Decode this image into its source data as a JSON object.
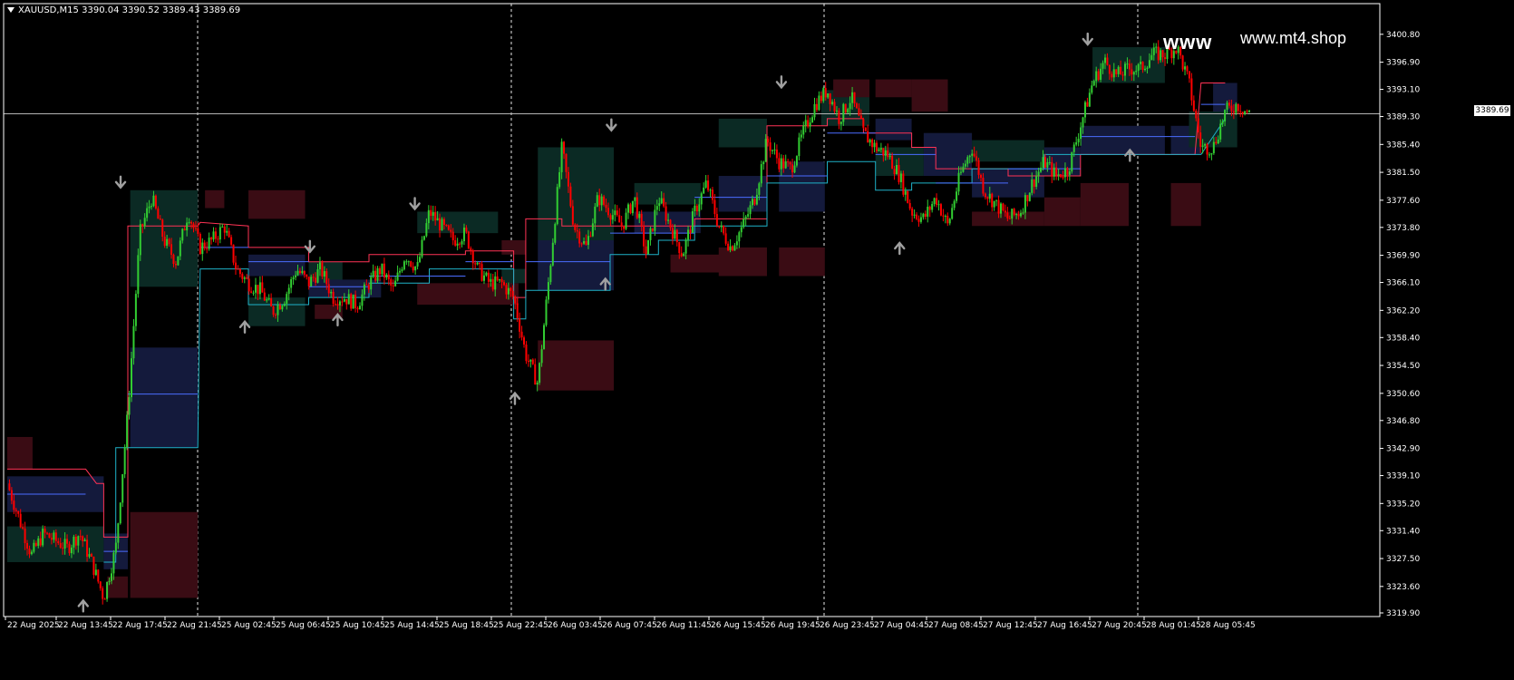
{
  "header": {
    "symbol": "XAUUSD,M15",
    "ohlc": "3390.04 3390.52 3389.43 3389.69"
  },
  "watermark": {
    "large": "www",
    "small": "www.mt4.shop"
  },
  "colors": {
    "background": "#000000",
    "grid": "#ffffff",
    "axis_text": "#ffffff",
    "bull": "#32cd32",
    "bear": "#ff0000",
    "arrow": "#a0a0a0",
    "zone_green": "#0b2a24",
    "zone_blue": "#141a3c",
    "zone_red": "#3a0c14",
    "resistance_line": "#ff3355",
    "support_line": "#1fb2c8",
    "mid_line": "#4a6cff",
    "bid_line": "#b4b4b4"
  },
  "chart_data": {
    "type": "candlestick",
    "symbol": "XAUUSD",
    "timeframe": "M15",
    "current_price": "3389.69",
    "ylim": [
      3319.9,
      3402.3
    ],
    "y_ticks": [
      "3400.80",
      "3396.90",
      "3393.10",
      "3389.30",
      "3385.40",
      "3381.50",
      "3377.60",
      "3373.80",
      "3369.90",
      "3366.10",
      "3362.20",
      "3358.40",
      "3354.50",
      "3350.60",
      "3346.80",
      "3342.90",
      "3339.10",
      "3335.20",
      "3331.40",
      "3327.50",
      "3323.60",
      "3319.90"
    ],
    "x_ticks": [
      "22 Aug 2025",
      "22 Aug 13:45",
      "22 Aug 17:45",
      "22 Aug 21:45",
      "25 Aug 02:45",
      "25 Aug 06:45",
      "25 Aug 10:45",
      "25 Aug 14:45",
      "25 Aug 18:45",
      "25 Aug 22:45",
      "26 Aug 03:45",
      "26 Aug 07:45",
      "26 Aug 11:45",
      "26 Aug 15:45",
      "26 Aug 19:45",
      "26 Aug 23:45",
      "27 Aug 04:45",
      "27 Aug 08:45",
      "27 Aug 12:45",
      "27 Aug 16:45",
      "27 Aug 20:45",
      "28 Aug 01:45",
      "28 Aug 05:45"
    ],
    "day_separators_after_tick": [
      2,
      8,
      14,
      19
    ],
    "price_path_anchors": [
      [
        0,
        3338
      ],
      [
        1,
        3333
      ],
      [
        2,
        3328
      ],
      [
        3,
        3331
      ],
      [
        4,
        3330
      ],
      [
        5,
        3329
      ],
      [
        6,
        3331
      ],
      [
        7,
        3327
      ],
      [
        8,
        3322
      ],
      [
        9,
        3329
      ],
      [
        10,
        3348
      ],
      [
        11,
        3373
      ],
      [
        12,
        3378
      ],
      [
        13,
        3372
      ],
      [
        14,
        3369
      ],
      [
        15,
        3376
      ],
      [
        16,
        3371
      ],
      [
        17,
        3372
      ],
      [
        18,
        3374
      ],
      [
        19,
        3368
      ],
      [
        20,
        3366
      ],
      [
        21,
        3365
      ],
      [
        22,
        3362
      ],
      [
        23,
        3364
      ],
      [
        24,
        3368
      ],
      [
        25,
        3366
      ],
      [
        26,
        3368
      ],
      [
        27,
        3364
      ],
      [
        28,
        3364
      ],
      [
        29,
        3363
      ],
      [
        30,
        3366
      ],
      [
        31,
        3368
      ],
      [
        32,
        3365
      ],
      [
        33,
        3370
      ],
      [
        34,
        3368
      ],
      [
        35,
        3376
      ],
      [
        36,
        3374
      ],
      [
        37,
        3372
      ],
      [
        38,
        3373
      ],
      [
        39,
        3368
      ],
      [
        40,
        3366
      ],
      [
        41,
        3366
      ],
      [
        42,
        3364
      ],
      [
        43,
        3356
      ],
      [
        44,
        3352
      ],
      [
        45,
        3368
      ],
      [
        46,
        3385
      ],
      [
        47,
        3374
      ],
      [
        48,
        3371
      ],
      [
        49,
        3378
      ],
      [
        50,
        3376
      ],
      [
        51,
        3374
      ],
      [
        52,
        3378
      ],
      [
        53,
        3370
      ],
      [
        54,
        3378
      ],
      [
        55,
        3374
      ],
      [
        56,
        3370
      ],
      [
        57,
        3376
      ],
      [
        58,
        3380
      ],
      [
        59,
        3374
      ],
      [
        60,
        3371
      ],
      [
        61,
        3374
      ],
      [
        62,
        3378
      ],
      [
        63,
        3386
      ],
      [
        64,
        3383
      ],
      [
        65,
        3382
      ],
      [
        66,
        3387
      ],
      [
        67,
        3391
      ],
      [
        68,
        3393
      ],
      [
        69,
        3389
      ],
      [
        70,
        3392
      ],
      [
        71,
        3387
      ],
      [
        72,
        3385
      ],
      [
        73,
        3384
      ],
      [
        74,
        3381
      ],
      [
        75,
        3376
      ],
      [
        76,
        3375
      ],
      [
        77,
        3378
      ],
      [
        78,
        3374
      ],
      [
        79,
        3381
      ],
      [
        80,
        3385
      ],
      [
        81,
        3379
      ],
      [
        82,
        3377
      ],
      [
        83,
        3375
      ],
      [
        84,
        3376
      ],
      [
        85,
        3380
      ],
      [
        86,
        3383
      ],
      [
        87,
        3381
      ],
      [
        88,
        3382
      ],
      [
        89,
        3388
      ],
      [
        90,
        3394
      ],
      [
        91,
        3397
      ],
      [
        92,
        3395
      ],
      [
        93,
        3396
      ],
      [
        94,
        3396
      ],
      [
        95,
        3398
      ],
      [
        96,
        3398
      ],
      [
        97,
        3399
      ],
      [
        98,
        3394
      ],
      [
        99,
        3385
      ],
      [
        100,
        3385
      ],
      [
        101,
        3390
      ],
      [
        102,
        3391
      ],
      [
        103,
        3389.7
      ]
    ],
    "zones": [
      {
        "x0": 0,
        "x1": 2.1,
        "y0": 3340,
        "y1": 3344.5,
        "kind": "red"
      },
      {
        "x0": 0,
        "x1": 8,
        "y0": 3332,
        "y1": 3327,
        "kind": "green"
      },
      {
        "x0": 0,
        "x1": 8,
        "y0": 3339,
        "y1": 3334,
        "kind": "blue"
      },
      {
        "x0": 8.3,
        "x1": 10,
        "y0": 3322,
        "y1": 3325,
        "kind": "red"
      },
      {
        "x0": 8,
        "x1": 10,
        "y0": 3331,
        "y1": 3326,
        "kind": "blue"
      },
      {
        "x0": 10.2,
        "x1": 15.8,
        "y0": 3322,
        "y1": 3334,
        "kind": "red"
      },
      {
        "x0": 10.2,
        "x1": 15.8,
        "y0": 3357,
        "y1": 3343,
        "kind": "blue"
      },
      {
        "x0": 10.2,
        "x1": 15.8,
        "y0": 3379,
        "y1": 3365.5,
        "kind": "green"
      },
      {
        "x0": 16.4,
        "x1": 18,
        "y0": 3376.5,
        "y1": 3379,
        "kind": "red"
      },
      {
        "x0": 20,
        "x1": 24.7,
        "y0": 3375,
        "y1": 3379,
        "kind": "red"
      },
      {
        "x0": 20,
        "x1": 24.7,
        "y0": 3367,
        "y1": 3370,
        "kind": "blue"
      },
      {
        "x0": 20,
        "x1": 24.7,
        "y0": 3364,
        "y1": 3360,
        "kind": "green"
      },
      {
        "x0": 25,
        "x1": 27.8,
        "y0": 3369,
        "y1": 3366,
        "kind": "green"
      },
      {
        "x0": 25.5,
        "x1": 27.8,
        "y0": 3361,
        "y1": 3363,
        "kind": "red"
      },
      {
        "x0": 25,
        "x1": 31,
        "y0": 3364,
        "y1": 3366.5,
        "kind": "blue"
      },
      {
        "x0": 34,
        "x1": 40.7,
        "y0": 3373,
        "y1": 3376,
        "kind": "green"
      },
      {
        "x0": 34,
        "x1": 42.4,
        "y0": 3363,
        "y1": 3366,
        "kind": "red"
      },
      {
        "x0": 41,
        "x1": 43,
        "y0": 3370,
        "y1": 3372,
        "kind": "red"
      },
      {
        "x0": 41,
        "x1": 43,
        "y0": 3366,
        "y1": 3368,
        "kind": "green"
      },
      {
        "x0": 44,
        "x1": 50.3,
        "y0": 3385,
        "y1": 3372,
        "kind": "green"
      },
      {
        "x0": 44,
        "x1": 50.3,
        "y0": 3372,
        "y1": 3365,
        "kind": "blue"
      },
      {
        "x0": 44,
        "x1": 50.3,
        "y0": 3358,
        "y1": 3351,
        "kind": "red"
      },
      {
        "x0": 52,
        "x1": 57.5,
        "y0": 3377,
        "y1": 3380,
        "kind": "green"
      },
      {
        "x0": 52,
        "x1": 57.5,
        "y0": 3373,
        "y1": 3376,
        "kind": "blue"
      },
      {
        "x0": 55,
        "x1": 61,
        "y0": 3370,
        "y1": 3367.5,
        "kind": "red"
      },
      {
        "x0": 59,
        "x1": 63,
        "y0": 3385,
        "y1": 3389,
        "kind": "green"
      },
      {
        "x0": 59,
        "x1": 63,
        "y0": 3376,
        "y1": 3381,
        "kind": "blue"
      },
      {
        "x0": 59,
        "x1": 63,
        "y0": 3371,
        "y1": 3367,
        "kind": "red"
      },
      {
        "x0": 64,
        "x1": 67.8,
        "y0": 3376,
        "y1": 3383,
        "kind": "blue"
      },
      {
        "x0": 64,
        "x1": 67.8,
        "y0": 3371,
        "y1": 3367,
        "kind": "red"
      },
      {
        "x0": 67.5,
        "x1": 71.5,
        "y0": 3388,
        "y1": 3393,
        "kind": "green"
      },
      {
        "x0": 68.5,
        "x1": 71.5,
        "y0": 3392,
        "y1": 3394.5,
        "kind": "red"
      },
      {
        "x0": 72,
        "x1": 75,
        "y0": 3392,
        "y1": 3394.5,
        "kind": "red"
      },
      {
        "x0": 72,
        "x1": 75,
        "y0": 3386,
        "y1": 3389,
        "kind": "blue"
      },
      {
        "x0": 75,
        "x1": 78,
        "y0": 3390,
        "y1": 3394.5,
        "kind": "red"
      },
      {
        "x0": 72,
        "x1": 76,
        "y0": 3381,
        "y1": 3385,
        "kind": "green"
      },
      {
        "x0": 76,
        "x1": 80,
        "y0": 3381,
        "y1": 3387,
        "kind": "blue"
      },
      {
        "x0": 80,
        "x1": 86,
        "y0": 3383,
        "y1": 3386,
        "kind": "green"
      },
      {
        "x0": 80,
        "x1": 86,
        "y0": 3374,
        "y1": 3376,
        "kind": "red"
      },
      {
        "x0": 80,
        "x1": 86,
        "y0": 3378,
        "y1": 3382,
        "kind": "blue"
      },
      {
        "x0": 86,
        "x1": 89,
        "y0": 3374,
        "y1": 3378,
        "kind": "red"
      },
      {
        "x0": 86,
        "x1": 89,
        "y0": 3381,
        "y1": 3385,
        "kind": "blue"
      },
      {
        "x0": 89,
        "x1": 93,
        "y0": 3374,
        "y1": 3380,
        "kind": "red"
      },
      {
        "x0": 89,
        "x1": 96,
        "y0": 3388,
        "y1": 3384,
        "kind": "blue"
      },
      {
        "x0": 90,
        "x1": 96,
        "y0": 3394,
        "y1": 3399,
        "kind": "green"
      },
      {
        "x0": 96.5,
        "x1": 99,
        "y0": 3374,
        "y1": 3380,
        "kind": "red"
      },
      {
        "x0": 96.5,
        "x1": 99,
        "y0": 3384,
        "y1": 3388,
        "kind": "blue"
      },
      {
        "x0": 98,
        "x1": 102,
        "y0": 3385,
        "y1": 3390,
        "kind": "green"
      },
      {
        "x0": 100,
        "x1": 102,
        "y0": 3390,
        "y1": 3394,
        "kind": "blue"
      }
    ],
    "resistance_line": [
      [
        0,
        3340
      ],
      [
        6.5,
        3340
      ],
      [
        7.4,
        3338
      ],
      [
        8,
        3338
      ],
      [
        8,
        3330.5
      ],
      [
        10,
        3330.5
      ],
      [
        10,
        3374
      ],
      [
        15.8,
        3374
      ],
      [
        16,
        3374.5
      ],
      [
        20,
        3374
      ],
      [
        20,
        3371
      ],
      [
        25,
        3371
      ],
      [
        25,
        3369
      ],
      [
        30,
        3369
      ],
      [
        30,
        3370
      ],
      [
        38,
        3370
      ],
      [
        38,
        3370.5
      ],
      [
        42,
        3370.5
      ],
      [
        42,
        3364
      ],
      [
        43,
        3364
      ],
      [
        43,
        3375
      ],
      [
        46,
        3375
      ],
      [
        46,
        3374
      ],
      [
        50,
        3374
      ],
      [
        50,
        3374
      ],
      [
        57,
        3374
      ],
      [
        57,
        3375
      ],
      [
        63,
        3375
      ],
      [
        63,
        3388
      ],
      [
        68,
        3388
      ],
      [
        68,
        3389
      ],
      [
        71,
        3389
      ],
      [
        71,
        3387
      ],
      [
        75,
        3387
      ],
      [
        75,
        3385
      ],
      [
        77,
        3385
      ],
      [
        77,
        3382
      ],
      [
        83,
        3382
      ],
      [
        83,
        3381
      ],
      [
        89,
        3381
      ],
      [
        89,
        3384
      ],
      [
        98.5,
        3384
      ],
      [
        98.5,
        3384
      ],
      [
        99,
        3394
      ],
      [
        101,
        3394
      ]
    ],
    "support_line": [
      [
        8,
        3327
      ],
      [
        9,
        3327
      ],
      [
        9,
        3343
      ],
      [
        15.8,
        3343
      ],
      [
        16,
        3368
      ],
      [
        20,
        3368
      ],
      [
        20,
        3363
      ],
      [
        25,
        3363
      ],
      [
        25,
        3364
      ],
      [
        30,
        3364
      ],
      [
        30,
        3366
      ],
      [
        35,
        3366
      ],
      [
        35,
        3368
      ],
      [
        38,
        3368
      ],
      [
        38,
        3368
      ],
      [
        42,
        3368
      ],
      [
        42,
        3361
      ],
      [
        43,
        3361
      ],
      [
        43,
        3365
      ],
      [
        50,
        3365
      ],
      [
        50,
        3370
      ],
      [
        54,
        3370
      ],
      [
        54,
        3372
      ],
      [
        57,
        3372
      ],
      [
        57,
        3374
      ],
      [
        63,
        3374
      ],
      [
        63,
        3380
      ],
      [
        68,
        3380
      ],
      [
        68,
        3383
      ],
      [
        72,
        3383
      ],
      [
        72,
        3379
      ],
      [
        75,
        3379
      ],
      [
        75,
        3380
      ],
      [
        80,
        3380
      ],
      [
        80,
        3382
      ],
      [
        86,
        3382
      ],
      [
        86,
        3384
      ],
      [
        99,
        3384
      ],
      [
        99,
        3384
      ],
      [
        101,
        3389
      ]
    ],
    "mid_lines": [
      {
        "x0": 0,
        "x1": 6.5,
        "y": 3336.5
      },
      {
        "x0": 8,
        "x1": 10,
        "y": 3328.5
      },
      {
        "x0": 10,
        "x1": 15.8,
        "y": 3350.5
      },
      {
        "x0": 16,
        "x1": 20,
        "y": 3371
      },
      {
        "x0": 20,
        "x1": 25,
        "y": 3369
      },
      {
        "x0": 25,
        "x1": 30,
        "y": 3365.5
      },
      {
        "x0": 30,
        "x1": 38,
        "y": 3367
      },
      {
        "x0": 38,
        "x1": 42,
        "y": 3369
      },
      {
        "x0": 43,
        "x1": 50,
        "y": 3369
      },
      {
        "x0": 50,
        "x1": 57,
        "y": 3373
      },
      {
        "x0": 57,
        "x1": 63,
        "y": 3378
      },
      {
        "x0": 63,
        "x1": 68,
        "y": 3381
      },
      {
        "x0": 68,
        "x1": 72,
        "y": 3387
      },
      {
        "x0": 72,
        "x1": 77,
        "y": 3384
      },
      {
        "x0": 77,
        "x1": 83,
        "y": 3380
      },
      {
        "x0": 83,
        "x1": 89,
        "y": 3382
      },
      {
        "x0": 89,
        "x1": 98.5,
        "y": 3386.5
      },
      {
        "x0": 99,
        "x1": 101,
        "y": 3391
      }
    ],
    "arrows_down": [
      [
        9.4,
        3379
      ],
      [
        25.1,
        3370
      ],
      [
        33.8,
        3376
      ],
      [
        50.1,
        3387
      ],
      [
        64.2,
        3393
      ],
      [
        89.6,
        3399
      ]
    ],
    "arrows_up": [
      [
        6.3,
        3322
      ],
      [
        19.7,
        3361
      ],
      [
        27.4,
        3362
      ],
      [
        42.1,
        3351
      ],
      [
        49.6,
        3367
      ],
      [
        74,
        3372
      ],
      [
        93.1,
        3385
      ]
    ]
  }
}
